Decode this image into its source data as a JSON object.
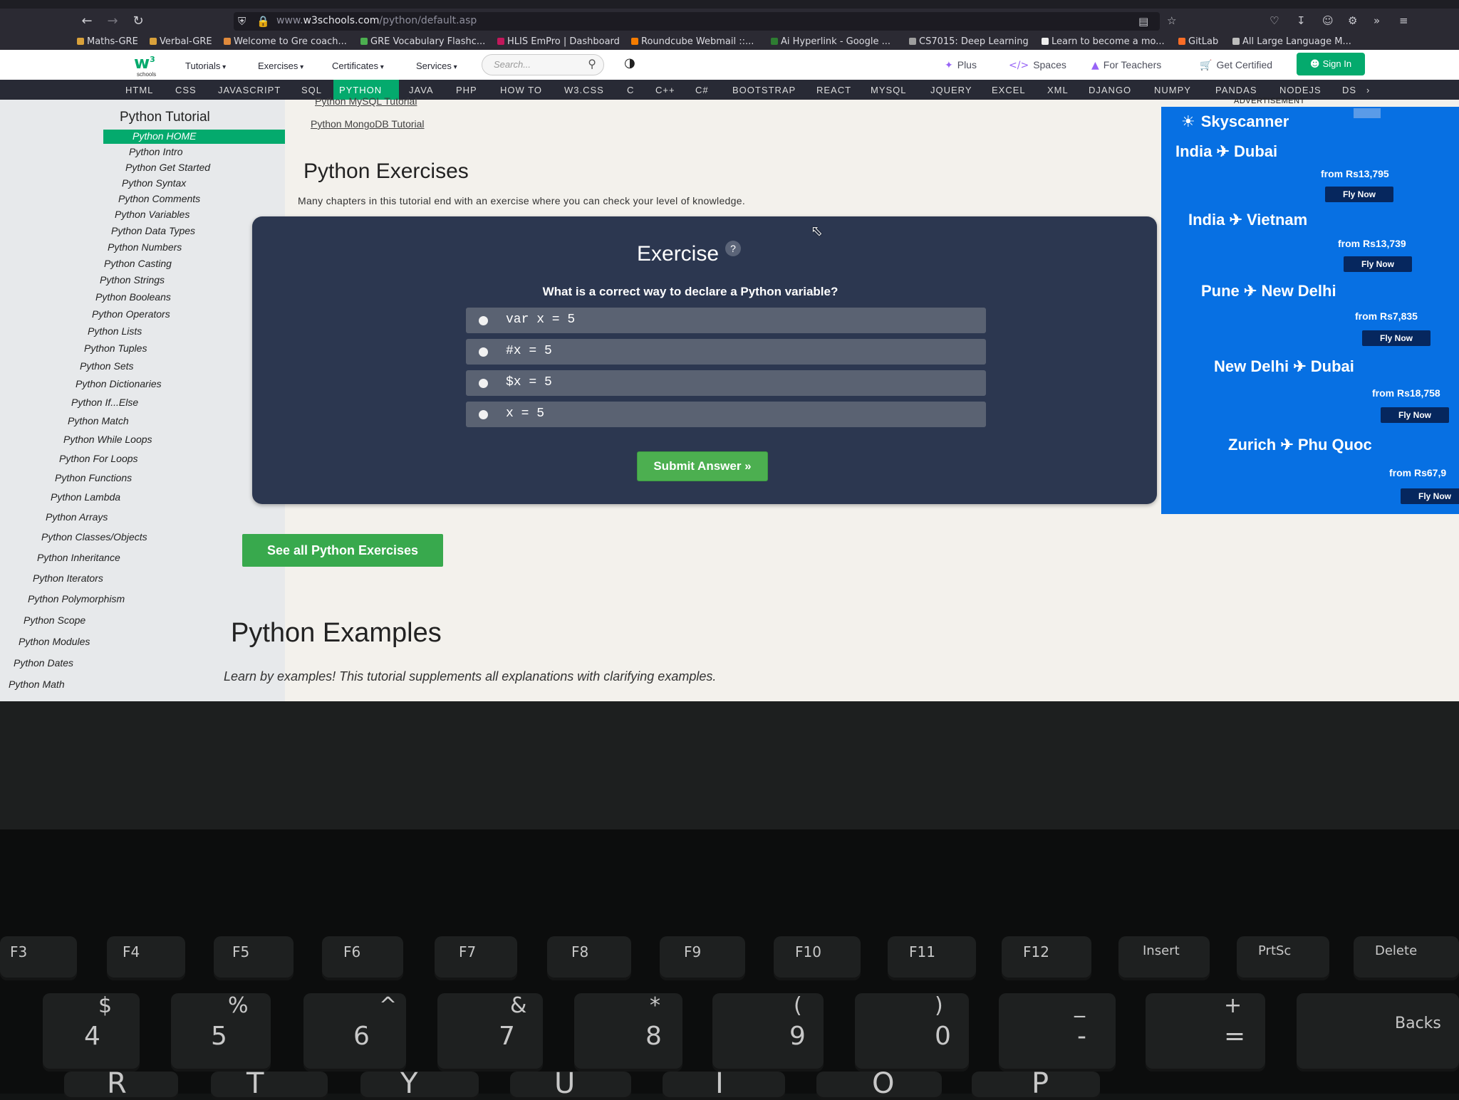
{
  "browser": {
    "url_prefix": "www.",
    "url_domain": "w3schools.com",
    "url_path": "/python/default.asp",
    "bookmarks": [
      {
        "label": "Maths-GRE",
        "color": "#d9a13b"
      },
      {
        "label": "Verbal-GRE",
        "color": "#d9a13b"
      },
      {
        "label": "Welcome to Gre coach...",
        "color": "#e08a3c"
      },
      {
        "label": "GRE Vocabulary Flashc...",
        "color": "#4caf50"
      },
      {
        "label": "HLIS EmPro | Dashboard",
        "color": "#c2185b"
      },
      {
        "label": "Roundcube Webmail ::...",
        "color": "#f57c00"
      },
      {
        "label": "Ai Hyperlink - Google ...",
        "color": "#2e7d32"
      },
      {
        "label": "CS7015: Deep Learning",
        "color": "#9e9e9e"
      },
      {
        "label": "Learn to become a mo...",
        "color": "#eeeeee"
      },
      {
        "label": "GitLab",
        "color": "#fc6d26"
      },
      {
        "label": "All Large Language M...",
        "color": "#bdbdbd"
      }
    ]
  },
  "w3header": {
    "menus": [
      "Tutorials",
      "Exercises",
      "Certificates",
      "Services"
    ],
    "search_placeholder": "Search...",
    "plus": "Plus",
    "spaces": "Spaces",
    "for_teachers": "For Teachers",
    "get_certified": "Get Certified",
    "sign_in": "Sign In"
  },
  "technav": [
    "HTML",
    "CSS",
    "JAVASCRIPT",
    "SQL",
    "PYTHON",
    "JAVA",
    "PHP",
    "HOW TO",
    "W3.CSS",
    "C",
    "C++",
    "C#",
    "BOOTSTRAP",
    "REACT",
    "MYSQL",
    "JQUERY",
    "EXCEL",
    "XML",
    "DJANGO",
    "NUMPY",
    "PANDAS",
    "NODEJS",
    "DS"
  ],
  "sidebar": {
    "title": "Python Tutorial",
    "items": [
      "Python HOME",
      "Python Intro",
      "Python Get Started",
      "Python Syntax",
      "Python Comments",
      "Python Variables",
      "Python Data Types",
      "Python Numbers",
      "Python Casting",
      "Python Strings",
      "Python Booleans",
      "Python Operators",
      "Python Lists",
      "Python Tuples",
      "Python Sets",
      "Python Dictionaries",
      "Python If...Else",
      "Python Match",
      "Python While Loops",
      "Python For Loops",
      "Python Functions",
      "Python Lambda",
      "Python Arrays",
      "Python Classes/Objects",
      "Python Inheritance",
      "Python Iterators",
      "Python Polymorphism",
      "Python Scope",
      "Python Modules",
      "Python Dates",
      "Python Math"
    ]
  },
  "main": {
    "links": [
      "Python MySQL Tutorial",
      "Python MongoDB Tutorial"
    ],
    "exercises_heading": "Python Exercises",
    "exercises_intro": "Many chapters in this tutorial end with an exercise where you can check your level of knowledge.",
    "exercise": {
      "title": "Exercise",
      "help": "?",
      "question": "What is a correct way to declare a Python variable?",
      "options": [
        "var x = 5",
        "#x = 5",
        "$x = 5",
        "x = 5"
      ],
      "submit": "Submit Answer »"
    },
    "see_all": "See all Python Exercises",
    "examples_heading": "Python Examples",
    "examples_intro": "Learn by examples! This tutorial supplements all explanations with clarifying examples."
  },
  "ad": {
    "label": "ADVERTISEMENT",
    "brand": "Skyscanner",
    "routes": [
      {
        "route": "India ✈ Dubai",
        "price": "from Rs13,795",
        "cta": "Fly Now"
      },
      {
        "route": "India ✈ Vietnam",
        "price": "from Rs13,739",
        "cta": "Fly Now"
      },
      {
        "route": "Pune ✈ New Delhi",
        "price": "from Rs7,835",
        "cta": "Fly Now"
      },
      {
        "route": "New Delhi ✈ Dubai",
        "price": "from Rs18,758",
        "cta": "Fly Now"
      },
      {
        "route": "Zurich ✈ Phu Quoc",
        "price": "from Rs67,9",
        "cta": "Fly Now"
      }
    ]
  },
  "keyboard": {
    "fkeys": [
      "F3",
      "F4",
      "F5",
      "F6",
      "F7",
      "F8",
      "F9",
      "F10",
      "F11",
      "F12",
      "Insert",
      "PrtSc",
      "Delete"
    ],
    "number_keys": [
      {
        "shift": "$",
        "main": "4"
      },
      {
        "shift": "%",
        "main": "5"
      },
      {
        "shift": "^",
        "main": "6"
      },
      {
        "shift": "&",
        "main": "7"
      },
      {
        "shift": "*",
        "main": "8"
      },
      {
        "shift": "(",
        "main": "9"
      },
      {
        "shift": ")",
        "main": "0"
      },
      {
        "shift": "_",
        "main": "-"
      },
      {
        "shift": "+",
        "main": "="
      },
      {
        "shift": "",
        "main": "Backs"
      }
    ],
    "letter_keys": [
      "R",
      "T",
      "Y",
      "U",
      "I",
      "O",
      "P"
    ]
  },
  "colors": {
    "w3_green": "#04aa6d",
    "exercise_bg": "#2c3750",
    "ad_blue": "#0770e3",
    "nav_dark": "#282a35"
  }
}
